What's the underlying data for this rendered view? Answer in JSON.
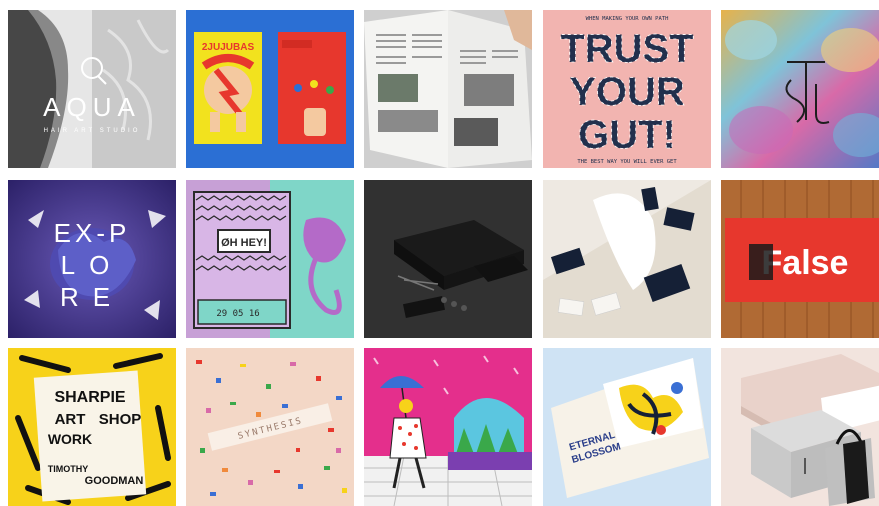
{
  "gallery": {
    "tiles": [
      {
        "id": "aqua",
        "texts": {
          "title": "AQUA",
          "subtitle": "HAIR ART STUDIO"
        }
      },
      {
        "id": "jujubas",
        "texts": {
          "brand": "2JUJUBAS"
        }
      },
      {
        "id": "magazine",
        "texts": {}
      },
      {
        "id": "trust",
        "texts": {
          "line1": "TRUST",
          "line2": "YOUR",
          "line3": "GUT!",
          "top": "WHEN MAKING YOUR OWN PATH",
          "bottom": "THE BEST WAY YOU WILL EVER GET"
        }
      },
      {
        "id": "monogram",
        "texts": {}
      },
      {
        "id": "explore",
        "texts": {
          "row1": "EX-P",
          "row2": "LO",
          "row3": "RE"
        }
      },
      {
        "id": "ohhey",
        "texts": {
          "sign": "ØH HEY!",
          "date": "29 05 16"
        }
      },
      {
        "id": "blackbox",
        "texts": {}
      },
      {
        "id": "cards",
        "texts": {}
      },
      {
        "id": "false",
        "texts": {
          "word": "False"
        }
      },
      {
        "id": "sharpie",
        "texts": {
          "l1": "SHARPIE",
          "l2": "ART",
          "l3": "WORK",
          "l4": "SHOP",
          "l5": "TIMOTHY",
          "l6": "GOODMAN"
        }
      },
      {
        "id": "confetti",
        "texts": {
          "label": "SYNTHESIS"
        }
      },
      {
        "id": "popart",
        "texts": {}
      },
      {
        "id": "eternal",
        "texts": {
          "title": "ETERNAL",
          "title2": "BLOSSOM"
        }
      },
      {
        "id": "packaging",
        "texts": {}
      }
    ]
  },
  "colors": {
    "blue": "#2b6fd4",
    "purple": "#4b3d8f",
    "orange": "#f08a3c",
    "red": "#e7372d",
    "yellow": "#f7d21a"
  }
}
